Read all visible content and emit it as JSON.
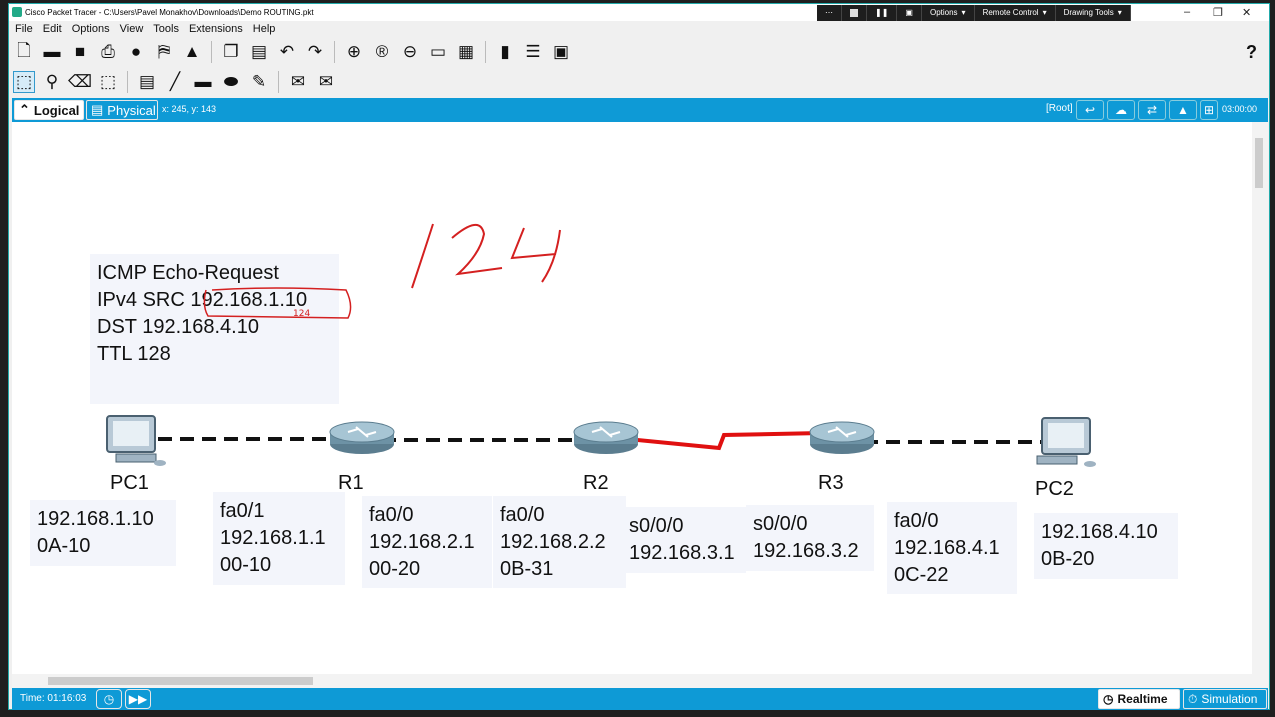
{
  "window": {
    "title": "Cisco Packet Tracer - C:\\Users\\Pavel Monakhov\\Downloads\\Demo ROUTING.pkt",
    "top_menus": [
      "Options",
      "Remote Control",
      "Drawing Tools"
    ]
  },
  "menu": [
    "File",
    "Edit",
    "Options",
    "View",
    "Tools",
    "Extensions",
    "Help"
  ],
  "toolbar": {
    "help": "?"
  },
  "tabs": {
    "logical": "Logical",
    "physical": "Physical"
  },
  "status": {
    "coords": "x: 245, y: 143",
    "root": "[Root]",
    "clock": "03:00:00"
  },
  "annotation": {
    "handwritten": "124"
  },
  "pdu_note": [
    "ICMP Echo-Request",
    "IPv4 SRC 192.168.1.10",
    "DST 192.168.4.10",
    "TTL 128"
  ],
  "devices": {
    "pc1": "PC1",
    "r1": "R1",
    "r2": "R2",
    "r3": "R3",
    "pc2": "PC2"
  },
  "interface_notes": [
    [
      "192.168.1.10",
      "0A-10"
    ],
    [
      "fa0/1",
      "192.168.1.1",
      "00-10"
    ],
    [
      "fa0/0",
      "192.168.2.1",
      "00-20"
    ],
    [
      "fa0/0",
      "192.168.2.2",
      "0B-31"
    ],
    [
      "s0/0/0",
      "192.168.3.1"
    ],
    [
      "s0/0/0",
      "192.168.3.2"
    ],
    [
      "fa0/0",
      "192.168.4.1",
      "0C-22"
    ],
    [
      "192.168.4.10",
      "0B-20"
    ]
  ],
  "bottom": {
    "time": "Time: 01:16:03",
    "realtime": "Realtime",
    "simulation": "Simulation"
  },
  "colors": {
    "accent": "#0e9ad6",
    "serial_link": "#e01010",
    "annotation_ink": "#d42020"
  }
}
